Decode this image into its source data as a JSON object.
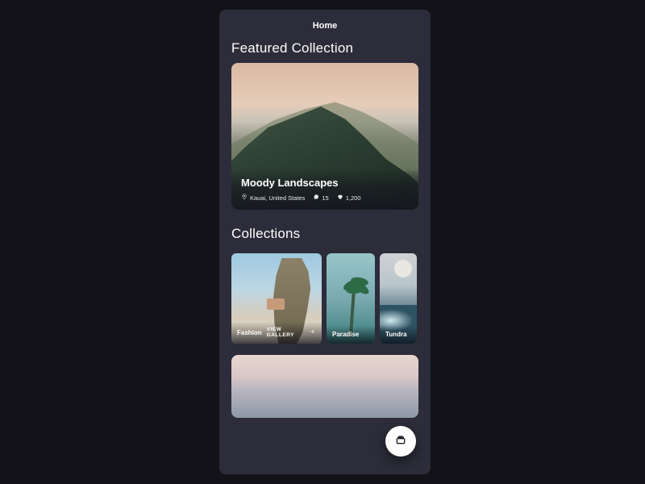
{
  "nav": {
    "title": "Home"
  },
  "featured": {
    "section_title": "Featured Collection",
    "title": "Moody Landscapes",
    "location": "Kauai, United States",
    "comments": "15",
    "likes": "1,200"
  },
  "collections": {
    "section_title": "Collections",
    "items": [
      {
        "label": "Fashion",
        "view_gallery": "VIEW GALLERY"
      },
      {
        "label": "Paradise"
      },
      {
        "label": "Tundra"
      }
    ]
  }
}
